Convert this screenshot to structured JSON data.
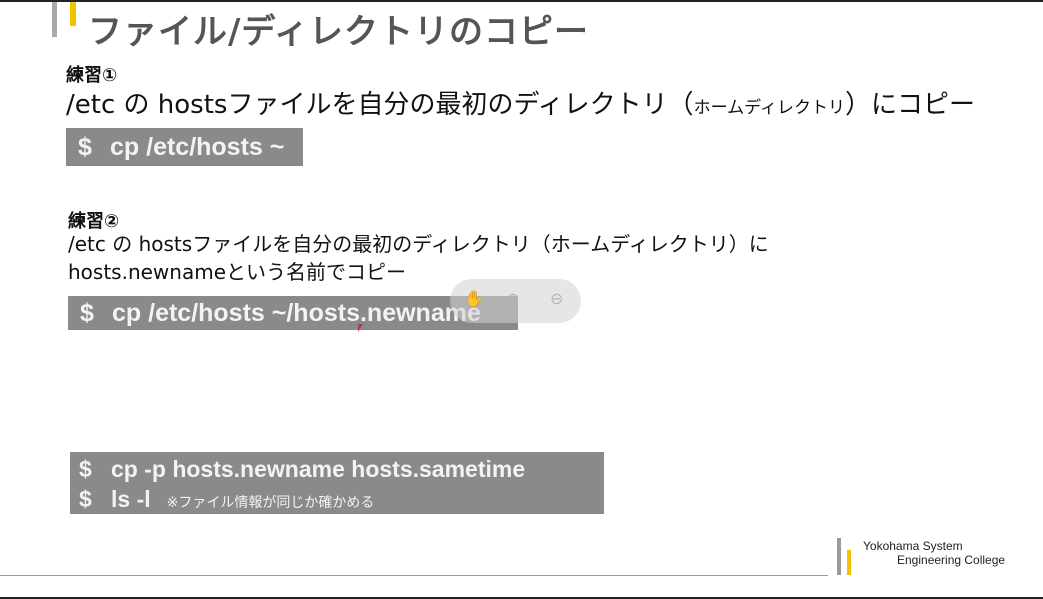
{
  "slide": {
    "title": "ファイル/ディレクトリのコピー",
    "exercise1": {
      "label": "練習①",
      "text_main": "/etc の hostsファイルを自分の最初のディレクトリ（",
      "text_small": "ホームディレクトリ",
      "text_end": "）にコピー",
      "command": {
        "prompt": "$",
        "text": "cp /etc/hosts ~"
      }
    },
    "exercise2": {
      "label": "練習②",
      "line1": "/etc の hostsファイルを自分の最初のディレクトリ（ホームディレクトリ）に",
      "line2": "hosts.newnameという名前でコピー",
      "command": {
        "prompt": "$",
        "text": "cp /etc/hosts ~/hosts.newname"
      }
    },
    "exercise3": {
      "commands": [
        {
          "prompt": "$",
          "text": "cp -p hosts.newname hosts.sametime",
          "note": ""
        },
        {
          "prompt": "$",
          "text": "ls -l",
          "note": "※ファイル情報が同じか確かめる"
        }
      ]
    },
    "logo": {
      "line1": "Yokohama System",
      "line2": "Engineering College"
    }
  },
  "overlay_controls": {
    "icons": [
      "hand-icon",
      "zoom-in-icon",
      "zoom-out-icon"
    ]
  },
  "colors": {
    "accent_yellow": "#f2c300",
    "command_bg": "#8a8a8a",
    "title": "#555555"
  }
}
